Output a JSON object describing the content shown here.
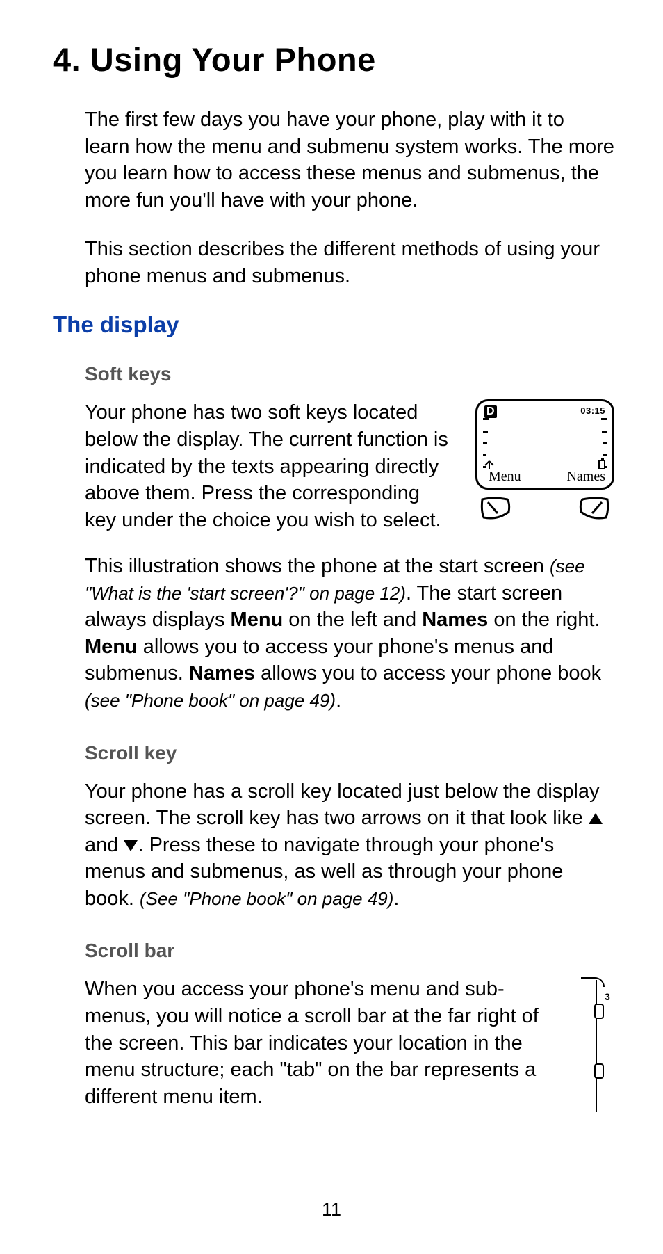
{
  "title": "4. Using Your Phone",
  "intro": {
    "p1": "The first few days you have your phone, play with it to learn how the menu and submenu system works. The more you learn how to access these menus and submenus, the more fun you'll have with your phone.",
    "p2": "This section describes the different methods of using your phone menus and submenus."
  },
  "section1": {
    "heading": "The display",
    "softkeys": {
      "heading": "Soft keys",
      "p1": "Your phone has two soft keys located below the display. The current function is indicated by the texts appearing directly above them. Press the corresponding key under the choice you wish to select.",
      "p2a": "This illustration shows the phone at the start screen ",
      "p2ref1": "(see \"What is the 'start screen'?\" on page 12)",
      "p2b": ". The start screen always displays ",
      "p2menu": "Menu",
      "p2c": " on the left and ",
      "p2names": "Names",
      "p2d": " on the right. ",
      "p2menu2": "Menu",
      "p2e": " allows you to access your phone's menus and submenus. ",
      "p2names2": "Names",
      "p2f": " allows you to access your phone book ",
      "p2ref2": "(see \"Phone book\" on page 49)",
      "p2g": "."
    },
    "scrollkey": {
      "heading": "Scroll key",
      "p_a": "Your phone has a scroll key located just below the display screen. The scroll key has two arrows on it that look like ",
      "p_b": " and ",
      "p_c": ". Press these to navigate through your phone's menus and submenus, as well as through your phone book. ",
      "p_ref": "(See \"Phone book\" on page 49)",
      "p_d": "."
    },
    "scrollbar": {
      "heading": "Scroll bar",
      "p": "When you access your phone's menu and sub-menus, you will notice a scroll bar at the far right of the screen. This bar indicates your location in the menu structure; each \"tab\" on the bar represents a different menu item."
    }
  },
  "phone_screen": {
    "indicator_letter": "D",
    "clock": "03:15",
    "left_label": "Menu",
    "right_label": "Names"
  },
  "scrollbar_illus": {
    "current_index": "3"
  },
  "page_number": "11"
}
